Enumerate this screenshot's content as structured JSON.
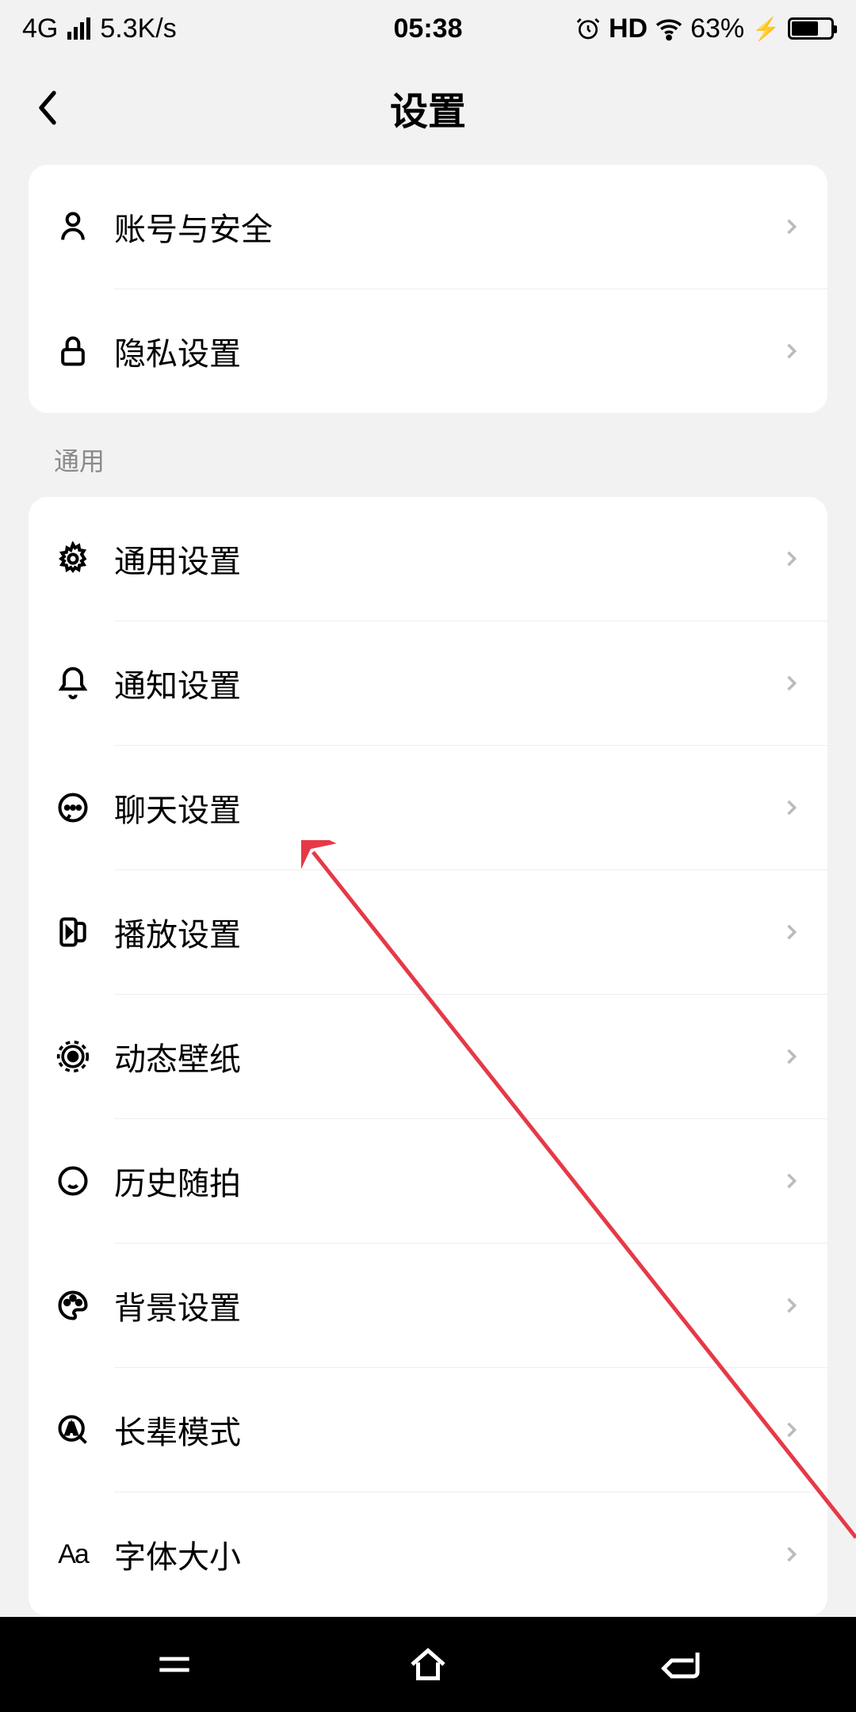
{
  "status": {
    "network": "4G",
    "speed": "5.3K/s",
    "time": "05:38",
    "hd": "HD",
    "battery_pct": "63%"
  },
  "header": {
    "title": "设置"
  },
  "group1": {
    "items": [
      {
        "label": "账号与安全",
        "icon": "person"
      },
      {
        "label": "隐私设置",
        "icon": "lock"
      }
    ]
  },
  "section2_label": "通用",
  "group2": {
    "items": [
      {
        "label": "通用设置",
        "icon": "gear"
      },
      {
        "label": "通知设置",
        "icon": "bell"
      },
      {
        "label": "聊天设置",
        "icon": "chat"
      },
      {
        "label": "播放设置",
        "icon": "play"
      },
      {
        "label": "动态壁纸",
        "icon": "wallpaper"
      },
      {
        "label": "历史随拍",
        "icon": "clock"
      },
      {
        "label": "背景设置",
        "icon": "palette"
      },
      {
        "label": "长辈模式",
        "icon": "elder"
      },
      {
        "label": "字体大小",
        "icon": "font"
      }
    ]
  }
}
